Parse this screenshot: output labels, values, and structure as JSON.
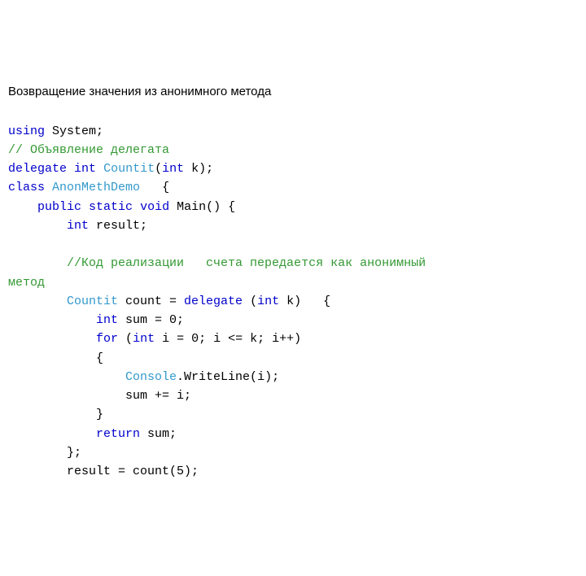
{
  "title": "Возвращение значения из анонимного метода",
  "code": {
    "t1": "using",
    "t2": " System;",
    "t3": "// Объявление делегата",
    "t4": "delegate",
    "t5": " ",
    "t6": "int",
    "t7": " ",
    "t8": "Countit",
    "t9": "(",
    "t10": "int",
    "t11": " k);",
    "t12": "class",
    "t13": " ",
    "t14": "AnonMethDemo",
    "t15": "   {",
    "t16": "    ",
    "t17": "public",
    "t18": " ",
    "t19": "static",
    "t20": " ",
    "t21": "void",
    "t22": " Main() {",
    "t23": "        ",
    "t24": "int",
    "t25": " result;",
    "t26": "        ",
    "t27": "//Код реализации   счета передается как анонимный",
    "t28": "метод",
    "t29": "        ",
    "t30": "Countit",
    "t31": " count = ",
    "t32": "delegate",
    "t33": " (",
    "t34": "int",
    "t35": " k)   {",
    "t36": "            ",
    "t37": "int",
    "t38": " sum = 0;",
    "t39": "            ",
    "t40": "for",
    "t41": " (",
    "t42": "int",
    "t43": " i = 0; i <= k; i++)",
    "t44": "            {",
    "t45": "                ",
    "t46": "Console",
    "t47": ".WriteLine(i);",
    "t48": "                sum += i;",
    "t49": "            }",
    "t50": "            ",
    "t51": "return",
    "t52": " sum;",
    "t53": "        };",
    "t54": "        result = count(5);"
  }
}
